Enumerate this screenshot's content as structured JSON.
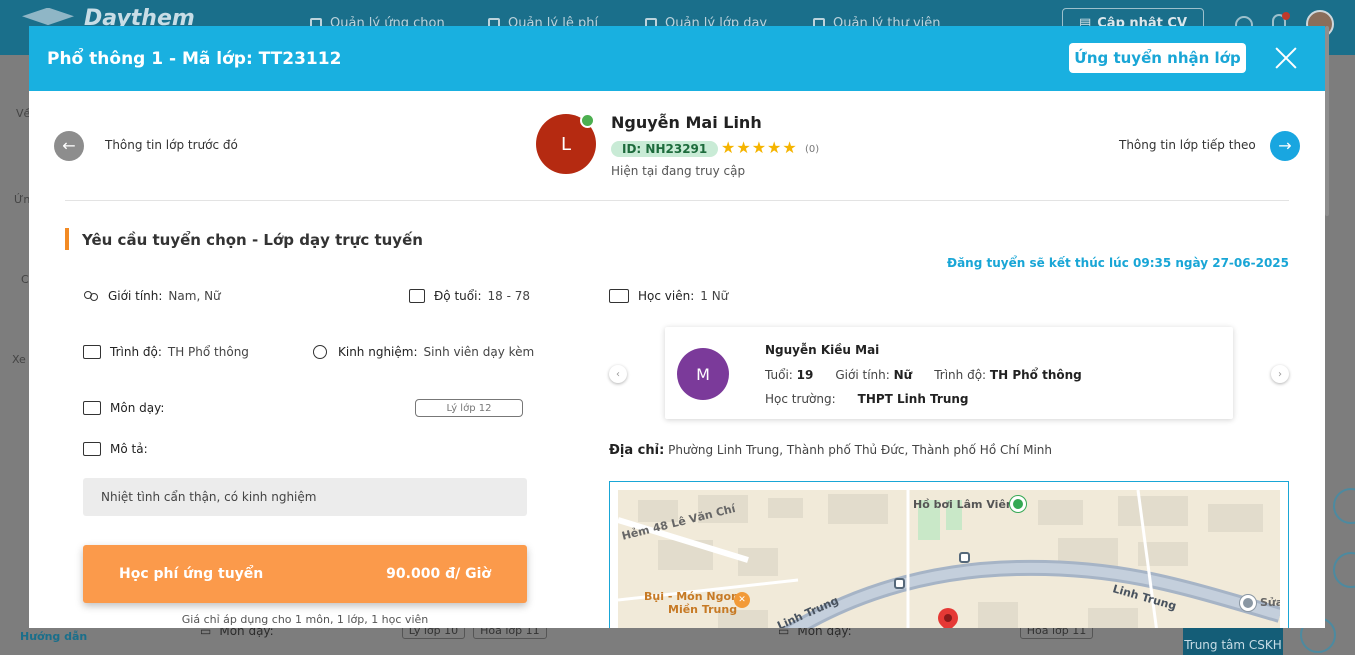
{
  "background": {
    "logo_text": "Daythem",
    "nav": [
      {
        "label": "Quản lý ứng chọn"
      },
      {
        "label": "Quản lý lệ phí"
      },
      {
        "label": "Quản lý lớp dạy"
      },
      {
        "label": "Quản lý thư viện"
      }
    ],
    "cv_button": "Cập nhật CV",
    "bottom_left_link": "Hướng dẫn",
    "bottom_subject_label": "Môn dạy:",
    "bottom_tags_left": [
      "Lý lớp 10",
      "Hóa lớp 11"
    ],
    "bottom_tags_right": [
      "Hóa lớp 11"
    ],
    "cskh_label": "Trung tâm CSKH",
    "left_edge_texts": [
      "Về",
      "Ứn",
      "C",
      "Xe"
    ]
  },
  "modal": {
    "title": "Phổ thông 1 - Mã lớp: TT23112",
    "apply_button": "Ứng tuyển nhận lớp",
    "prev_label": "Thông tin lớp trước đó",
    "next_label": "Thông tin lớp tiếp theo",
    "prev_arrow": "←",
    "next_arrow": "→"
  },
  "tutor": {
    "initial": "L",
    "name": "Nguyễn Mai Linh",
    "id_badge": "ID: NH23291",
    "rating_count": "(0)",
    "status": "Hiện tại đang truy cập"
  },
  "requirements": {
    "title": "Yêu cầu tuyển chọn - Lớp dạy trực tuyến",
    "deadline": "Đăng tuyển sẽ kết thúc lúc 09:35 ngày 27-06-2025",
    "gender_label": "Giới tính:",
    "gender_value": "Nam, Nữ",
    "age_label": "Độ tuổi:",
    "age_value": "18 - 78",
    "students_label": "Học viên:",
    "students_value": "1 Nữ",
    "level_label": "Trình độ:",
    "level_value": "TH Phổ thông",
    "experience_label": "Kinh nghiệm:",
    "experience_value": "Sinh viên dạy kèm",
    "subject_label": "Môn dạy:",
    "subject_tag": "Lý lớp 12",
    "desc_label": "Mô tả:",
    "desc_value": "Nhiệt tình cẩn thận, có kinh nghiệm",
    "fee_label": "Học phí ứng tuyển",
    "fee_value": "90.000 đ/ Giờ",
    "fee_note": "Giá chỉ áp dụng cho 1 môn, 1 lớp, 1 học viên"
  },
  "student": {
    "initial": "M",
    "name": "Nguyễn Kiều Mai",
    "age_label": "Tuổi:",
    "age_value": "19",
    "gender_label": "Giới tính:",
    "gender_value": "Nữ",
    "level_label": "Trình độ:",
    "level_value": "TH Phổ thông",
    "school_label": "Học trường:",
    "school_value": "THPT Linh Trung"
  },
  "address": {
    "label": "Địa chỉ:",
    "value": "Phường Linh Trung, Thành phố Thủ Đức, Thành phố Hồ Chí Minh"
  },
  "map": {
    "labels": {
      "pool": "Hồ bơi Lâm Viên",
      "alley": "Hẻm 48 Lê Văn Chí",
      "restaurant_1": "Bụi - Món Ngon",
      "restaurant_2": "Miền Trung",
      "road_1": "Linh Trung",
      "road_2": "Linh Trung",
      "poi_right": "Sửa"
    }
  },
  "colors": {
    "header": "#19b0e0",
    "fee": "#fb9a4b",
    "accent_orange": "#f28a24",
    "star": "#f5b400"
  }
}
